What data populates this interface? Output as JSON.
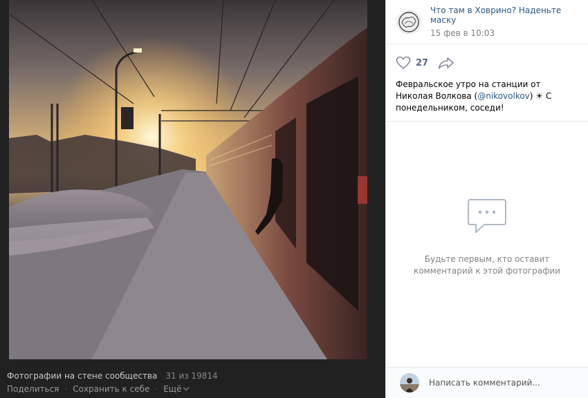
{
  "photo": {
    "alt": "",
    "album_title": "Фотографии на стене сообщества",
    "counter": "31 из 19814",
    "actions": {
      "share": "Поделиться",
      "save": "Сохранить к себе",
      "more": "Ещё"
    }
  },
  "post": {
    "community_name": "Что там в Ховрино? Наденьте маску",
    "date": "15 фев в 10:03",
    "likes": "27",
    "text_before": "Февральское утро на станции от Николая Волкова (",
    "link": "@nikovolkov",
    "text_after": ") ☀ С понедельником, соседи!"
  },
  "comments": {
    "empty_line1": "Будьте первым, кто оставит",
    "empty_line2": "комментарий к этой фотографии",
    "input_placeholder": "Написать комментарий..."
  },
  "colors": {
    "link": "#2a5885",
    "dark_bg": "#212121",
    "icon": "#828a99"
  },
  "icons": {
    "like": "heart-icon",
    "share": "share-arrow-icon",
    "empty_comments": "speech-bubble-icon"
  }
}
